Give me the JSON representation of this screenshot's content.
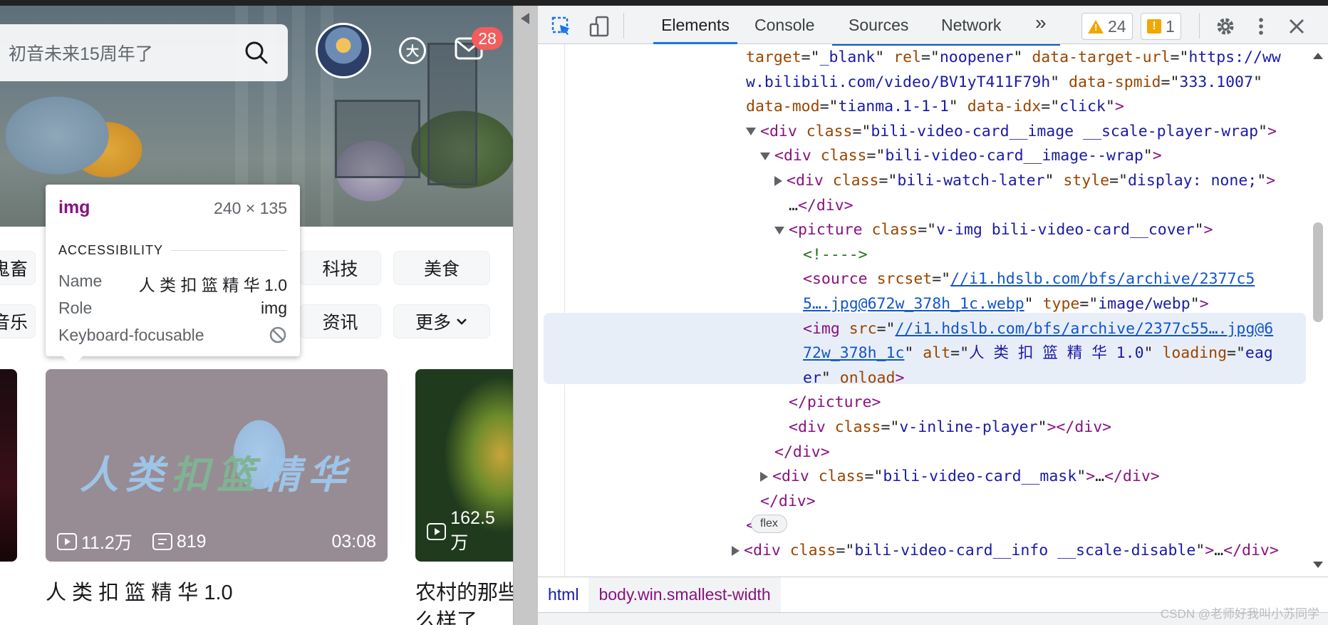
{
  "site": {
    "search_placeholder": "初音未来15周年了",
    "message_badge": "28",
    "big_member_label": "大",
    "chips": [
      "鬼畜",
      "科技",
      "美食",
      "音乐",
      "资讯",
      "更多"
    ],
    "tooltip": {
      "tag": "img",
      "dims": "240 × 135",
      "section": "ACCESSIBILITY",
      "rows": [
        {
          "key": "Name",
          "value": "人 类 扣 篮 精 华 1.0"
        },
        {
          "key": "Role",
          "value": "img"
        },
        {
          "key": "Keyboard-focusable",
          "value": ""
        }
      ]
    },
    "card1": {
      "title_art_a": "人类",
      "title_art_b": "扣篮",
      "title_art_c": "精华",
      "views": "11.2万",
      "danmaku": "819",
      "duration": "03:08",
      "title": "人 类 扣 篮 精 华 1.0"
    },
    "card2": {
      "views": "162.5万",
      "title_line1": "农村的那些",
      "title_line2": "么样了"
    }
  },
  "devtools": {
    "tabs": [
      "Elements",
      "Console",
      "Sources",
      "Network"
    ],
    "more_tabs": "»",
    "warnings": "24",
    "issues": "1",
    "lines": [
      {
        "indent": 0,
        "t": [
          [
            "an",
            "target"
          ],
          [
            "txt",
            "=\""
          ],
          [
            "av",
            "_blank"
          ],
          [
            "txt",
            "\" "
          ],
          [
            "an",
            "rel"
          ],
          [
            "txt",
            "=\""
          ],
          [
            "av",
            "noopener"
          ],
          [
            "txt",
            "\" "
          ],
          [
            "an",
            "data-target-url"
          ],
          [
            "txt",
            "=\""
          ],
          [
            "av",
            "https://ww"
          ]
        ]
      },
      {
        "indent": 0,
        "t": [
          [
            "av",
            "w.bilibili.com/video/BV1yT411F79h"
          ],
          [
            "txt",
            "\" "
          ],
          [
            "an",
            "data-spmid"
          ],
          [
            "txt",
            "=\""
          ],
          [
            "av",
            "333.1007"
          ],
          [
            "txt",
            "\""
          ]
        ]
      },
      {
        "indent": 0,
        "t": [
          [
            "an",
            "data-mod"
          ],
          [
            "txt",
            "=\""
          ],
          [
            "av",
            "tianma.1-1-1"
          ],
          [
            "txt",
            "\" "
          ],
          [
            "an",
            "data-idx"
          ],
          [
            "txt",
            "=\""
          ],
          [
            "av",
            "click"
          ],
          [
            "txt",
            "\""
          ],
          [
            "tag",
            ">"
          ]
        ]
      },
      {
        "indent": 1,
        "caret": "down",
        "t": [
          [
            "tag",
            "<div "
          ],
          [
            "an",
            "class"
          ],
          [
            "txt",
            "=\""
          ],
          [
            "av",
            "bili-video-card__image __scale-player-wrap"
          ],
          [
            "txt",
            "\""
          ],
          [
            "tag",
            ">"
          ]
        ]
      },
      {
        "indent": 2,
        "caret": "down",
        "t": [
          [
            "tag",
            "<div "
          ],
          [
            "an",
            "class"
          ],
          [
            "txt",
            "=\""
          ],
          [
            "av",
            "bili-video-card__image--wrap"
          ],
          [
            "txt",
            "\""
          ],
          [
            "tag",
            ">"
          ]
        ]
      },
      {
        "indent": 3,
        "caret": "right",
        "t": [
          [
            "tag",
            "<div "
          ],
          [
            "an",
            "class"
          ],
          [
            "txt",
            "=\""
          ],
          [
            "av",
            "bili-watch-later"
          ],
          [
            "txt",
            "\" "
          ],
          [
            "an",
            "style"
          ],
          [
            "txt",
            "=\""
          ],
          [
            "av",
            "display: none;"
          ],
          [
            "txt",
            "\""
          ],
          [
            "tag",
            ">"
          ]
        ]
      },
      {
        "indent": 3,
        "t": [
          [
            "txt",
            "…"
          ],
          [
            "tag",
            "</div>"
          ]
        ]
      },
      {
        "indent": 3,
        "caret": "down",
        "t": [
          [
            "tag",
            "<picture "
          ],
          [
            "an",
            "class"
          ],
          [
            "txt",
            "=\""
          ],
          [
            "av",
            "v-img bili-video-card__cover"
          ],
          [
            "txt",
            "\""
          ],
          [
            "tag",
            ">"
          ]
        ]
      },
      {
        "indent": 4,
        "t": [
          [
            "cm",
            "<!---->"
          ]
        ]
      },
      {
        "indent": 4,
        "t": [
          [
            "tag",
            "<source "
          ],
          [
            "an",
            "srcset"
          ],
          [
            "txt",
            "=\""
          ],
          [
            "link",
            "//i1.hdslb.com/bfs/archive/2377c5"
          ]
        ]
      },
      {
        "indent": 4,
        "t": [
          [
            "link",
            "5….jpg@672w_378h_1c.webp"
          ],
          [
            "txt",
            "\" "
          ],
          [
            "an",
            "type"
          ],
          [
            "txt",
            "=\""
          ],
          [
            "av",
            "image/webp"
          ],
          [
            "txt",
            "\""
          ],
          [
            "tag",
            ">"
          ]
        ]
      },
      {
        "indent": 4,
        "t": [
          [
            "tag",
            "<img "
          ],
          [
            "an",
            "src"
          ],
          [
            "txt",
            "=\""
          ],
          [
            "link",
            "//i1.hdslb.com/bfs/archive/2377c55….jpg@6"
          ]
        ]
      },
      {
        "indent": 4,
        "t": [
          [
            "link",
            "72w_378h_1c"
          ],
          [
            "txt",
            "\" "
          ],
          [
            "an",
            "alt"
          ],
          [
            "txt",
            "=\""
          ],
          [
            "av",
            "人 类 扣 篮 精 华 1.0"
          ],
          [
            "txt",
            "\" "
          ],
          [
            "an",
            "loading"
          ],
          [
            "txt",
            "=\""
          ],
          [
            "av",
            "eag"
          ]
        ]
      },
      {
        "indent": 4,
        "t": [
          [
            "av",
            "er"
          ],
          [
            "txt",
            "\" "
          ],
          [
            "an",
            "onload"
          ],
          [
            "tag",
            ">"
          ]
        ]
      },
      {
        "indent": 3,
        "t": [
          [
            "tag",
            "</picture>"
          ]
        ]
      },
      {
        "indent": 3,
        "t": [
          [
            "tag",
            "<div "
          ],
          [
            "an",
            "class"
          ],
          [
            "txt",
            "=\""
          ],
          [
            "av",
            "v-inline-player"
          ],
          [
            "txt",
            "\""
          ],
          [
            "tag",
            "></div>"
          ]
        ]
      },
      {
        "indent": 2,
        "t": [
          [
            "tag",
            "</div>"
          ]
        ]
      },
      {
        "indent": 2,
        "caret": "right",
        "t": [
          [
            "tag",
            "<div "
          ],
          [
            "an",
            "class"
          ],
          [
            "txt",
            "=\""
          ],
          [
            "av",
            "bili-video-card__mask"
          ],
          [
            "txt",
            "\""
          ],
          [
            "tag",
            ">"
          ],
          [
            "txt",
            "…"
          ],
          [
            "tag",
            "</div>"
          ]
        ]
      },
      {
        "indent": 1,
        "t": [
          [
            "tag",
            "</div>"
          ]
        ]
      },
      {
        "indent": 0,
        "t": [
          [
            "tag",
            "</a>"
          ]
        ]
      },
      {
        "indent": 0,
        "caret": "right",
        "t": [
          [
            "tag",
            "<div "
          ],
          [
            "an",
            "class"
          ],
          [
            "txt",
            "=\""
          ],
          [
            "av",
            "bili-video-card__info __scale-disable"
          ],
          [
            "txt",
            "\""
          ],
          [
            "tag",
            ">"
          ],
          [
            "txt",
            "…"
          ],
          [
            "tag",
            "</div>"
          ]
        ]
      }
    ],
    "flex_badge": "flex",
    "breadcrumbs": [
      "html",
      "body.win.smallest-width"
    ],
    "watermark": "CSDN @老师好我叫小苏同学"
  },
  "colors": {
    "accent": "#1a73e8",
    "badge": "#f25d5d",
    "warning": "#f2a600",
    "tag": "#881280",
    "attr_name": "#994500",
    "attr_value": "#1a1aa6"
  }
}
